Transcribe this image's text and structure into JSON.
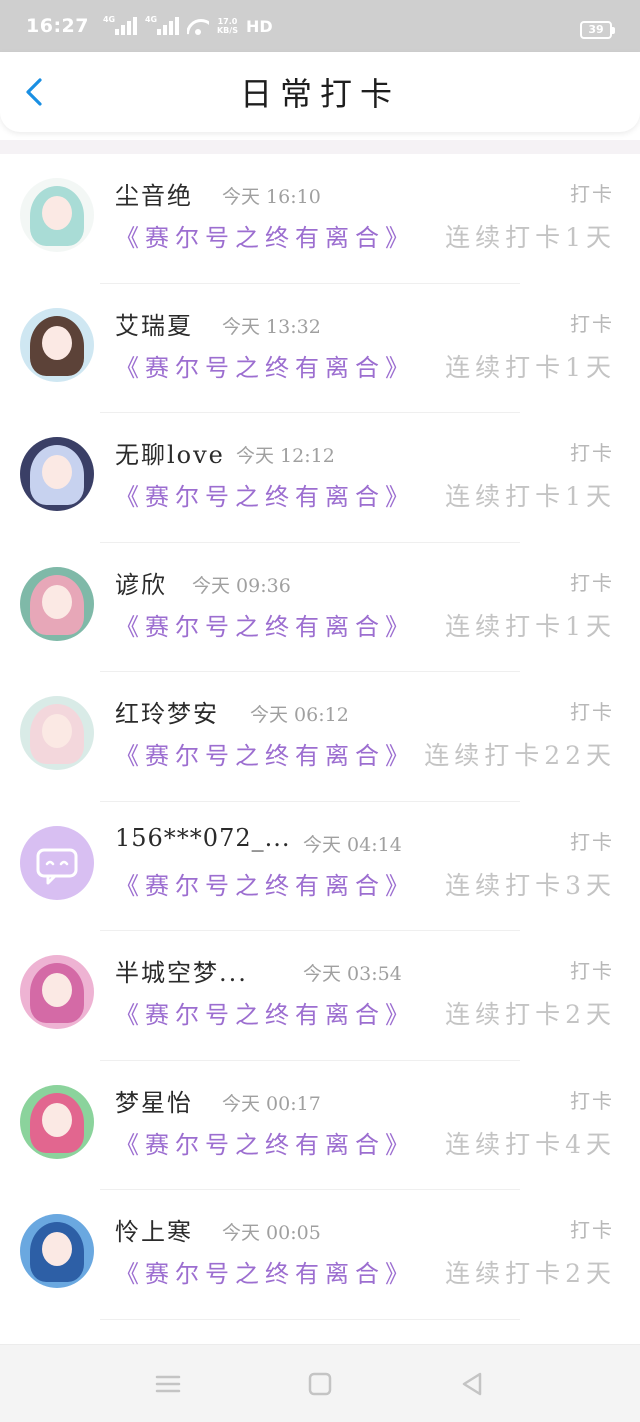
{
  "status_bar": {
    "time": "16:27",
    "net1": "4G",
    "net2": "4G",
    "speed_value": "17.0",
    "speed_unit": "KB/S",
    "hd": "HD",
    "battery": "39"
  },
  "header": {
    "title": "日常打卡",
    "back_icon": "chevron-left-icon"
  },
  "colors": {
    "accent_blue": "#1a8fe3",
    "topic_purple": "#9c6ed0",
    "muted_gray": "#c4c4c4"
  },
  "entries": [
    {
      "name": "尘音绝",
      "time": "今天 16:10",
      "action": "打卡",
      "topic": "《赛尔号之终有离合》",
      "streak": "连续打卡1天"
    },
    {
      "name": "艾瑞夏",
      "time": "今天 13:32",
      "action": "打卡",
      "topic": "《赛尔号之终有离合》",
      "streak": "连续打卡1天"
    },
    {
      "name": "无聊love",
      "time": "今天 12:12",
      "action": "打卡",
      "topic": "《赛尔号之终有离合》",
      "streak": "连续打卡1天"
    },
    {
      "name": "谚欣",
      "time": "今天 09:36",
      "action": "打卡",
      "topic": "《赛尔号之终有离合》",
      "streak": "连续打卡1天"
    },
    {
      "name": "红玲梦安",
      "time": "今天 06:12",
      "action": "打卡",
      "topic": "《赛尔号之终有离合》",
      "streak": "连续打卡22天"
    },
    {
      "name": "156***072_...",
      "time": "今天 04:14",
      "action": "打卡",
      "topic": "《赛尔号之终有离合》",
      "streak": "连续打卡3天"
    },
    {
      "name": "半城空梦...",
      "time": "今天 03:54",
      "action": "打卡",
      "topic": "《赛尔号之终有离合》",
      "streak": "连续打卡2天"
    },
    {
      "name": "梦星怡",
      "time": "今天 00:17",
      "action": "打卡",
      "topic": "《赛尔号之终有离合》",
      "streak": "连续打卡4天"
    },
    {
      "name": "怜上寒",
      "time": "今天 00:05",
      "action": "打卡",
      "topic": "《赛尔号之终有离合》",
      "streak": "连续打卡2天"
    }
  ],
  "navbar": {
    "menu_icon": "menu-icon",
    "home_icon": "home-square-icon",
    "back_icon": "back-triangle-icon"
  }
}
